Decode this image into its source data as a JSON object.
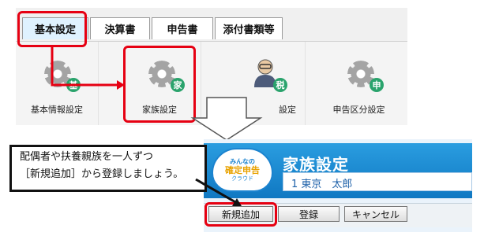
{
  "tabs": [
    {
      "label": "基本設定",
      "active": true
    },
    {
      "label": "決算書",
      "active": false
    },
    {
      "label": "申告書",
      "active": false
    },
    {
      "label": "添付書類等",
      "active": false
    }
  ],
  "tiles": [
    {
      "label": "基本情報設定",
      "icon": "gear-icon",
      "badge": "基"
    },
    {
      "label": "家族設定",
      "icon": "gear-icon",
      "badge": "家"
    },
    {
      "label": "税理士設定",
      "label_visible": "設定",
      "icon": "person-icon",
      "badge": "税"
    },
    {
      "label": "申告区分設定",
      "icon": "gear-icon",
      "badge": "申"
    }
  ],
  "callout": {
    "line1": "配偶者や扶養親族を一人ずつ",
    "line2": "［新規追加］から登録しましょう。"
  },
  "screen": {
    "title": "家族設定",
    "subtitle": "1 東京　太郎",
    "logo": {
      "line1": "みんなの",
      "line2": "確定申告",
      "line3": "クラウド"
    }
  },
  "buttons": {
    "add": "新規追加",
    "register": "登録",
    "cancel": "キャンセル"
  },
  "colors": {
    "highlight": "#e60012",
    "header": "#1b83cf",
    "badge": "#2aa36c"
  }
}
